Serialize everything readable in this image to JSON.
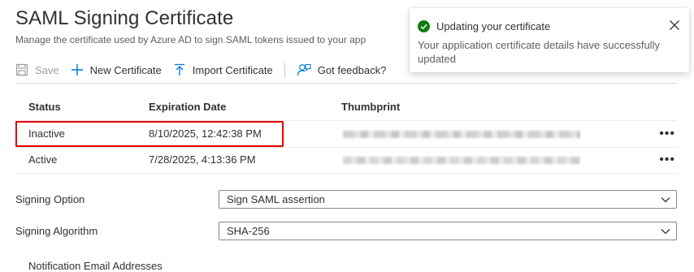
{
  "header": {
    "title": "SAML Signing Certificate",
    "subtitle": "Manage the certificate used by Azure AD to sign SAML tokens issued to your app"
  },
  "toolbar": {
    "save_label": "Save",
    "new_certificate_label": "New Certificate",
    "import_certificate_label": "Import Certificate",
    "feedback_label": "Got feedback?"
  },
  "table": {
    "columns": [
      "Status",
      "Expiration Date",
      "Thumbprint"
    ],
    "rows": [
      {
        "status": "Inactive",
        "expiration": "8/10/2025, 12:42:38 PM",
        "more": "•••"
      },
      {
        "status": "Active",
        "expiration": "7/28/2025, 4:13:36 PM",
        "more": "•••"
      }
    ]
  },
  "form": {
    "signing_option_label": "Signing Option",
    "signing_option_value": "Sign SAML assertion",
    "signing_algorithm_label": "Signing Algorithm",
    "signing_algorithm_value": "SHA-256",
    "notification_label": "Notification Email Addresses"
  },
  "toast": {
    "title": "Updating your certificate",
    "body": "Your application certificate details have successfully updated"
  },
  "colors": {
    "accent": "#0078d4",
    "success": "#107c10",
    "highlight": "#e00000"
  },
  "icons": {
    "save": "save-icon",
    "new": "plus-icon",
    "import": "upload-icon",
    "feedback": "feedback-icon",
    "success": "check-circle-icon",
    "close": "close-icon",
    "chevron": "chevron-down-icon"
  }
}
